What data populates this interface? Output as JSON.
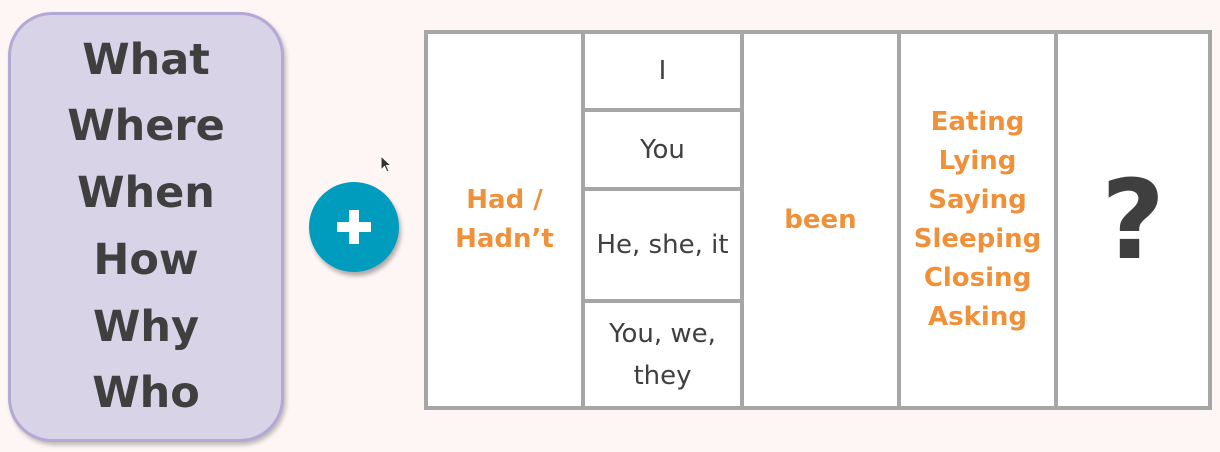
{
  "question_words": [
    "What",
    "Where",
    "When",
    "How",
    "Why",
    "Who"
  ],
  "plus_label": "+",
  "table": {
    "auxiliary": "Had / Hadn’t",
    "subjects": [
      "I",
      "You",
      "He, she, it",
      "You, we, they"
    ],
    "been": "been",
    "verbs": [
      "Eating",
      "Lying",
      "Saying",
      "Sleeping",
      "Closing",
      "Asking"
    ],
    "ending": "?"
  },
  "colors": {
    "accent_orange": "#f0913a",
    "plus_blue": "#009cbe",
    "box_purple": "#d8d3e6"
  }
}
